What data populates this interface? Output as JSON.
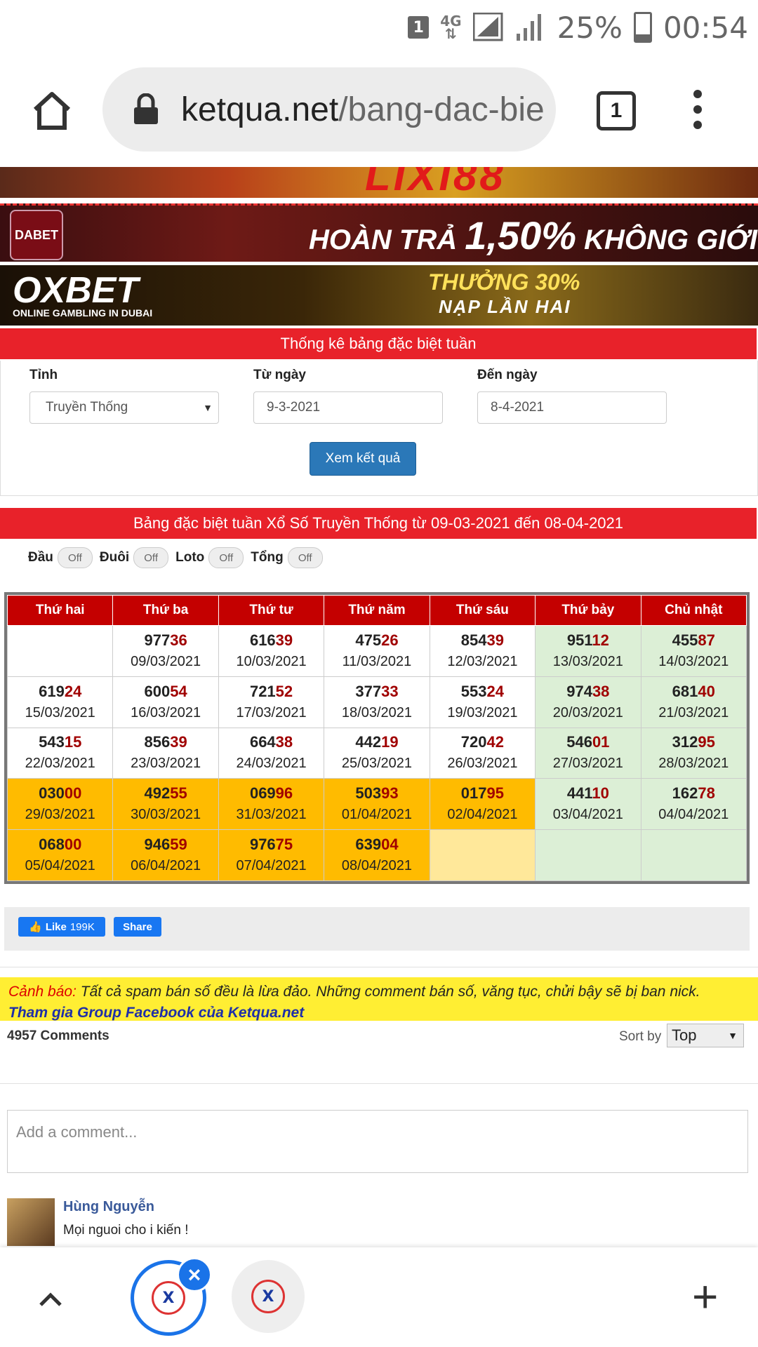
{
  "status_bar": {
    "sim_badge": "1",
    "network": "4G",
    "battery": "25%",
    "time": "00:54"
  },
  "browser": {
    "url_host": "ketqua.net",
    "url_path": "/bang-dac-bie",
    "tab_count": "1"
  },
  "banners": {
    "b1_text": "LIXI88",
    "b2_logo": "DABET",
    "b2_text_a": "HOÀN TRẢ ",
    "b2_text_b": "1,50%",
    "b2_text_c": " KHÔNG GIỚI HẠN",
    "b3_logo": "OXBET",
    "b3_logo_sub": "ONLINE GAMBLING IN DUBAI",
    "b3_text_1": "THƯỞNG 30%",
    "b3_text_2": "NẠP LẦN HAI"
  },
  "form": {
    "title": "Thống kê bảng đặc biệt tuần",
    "province_label": "Tỉnh",
    "province_value": "Truyền Thống",
    "from_label": "Từ ngày",
    "from_value": "9-3-2021",
    "to_label": "Đến ngày",
    "to_value": "8-4-2021",
    "submit_label": "Xem kết quả"
  },
  "table_section": {
    "title": "Bảng đặc biệt tuần Xổ Số Truyền Thống từ 09-03-2021 đến 08-04-2021",
    "toggles": [
      {
        "label": "Đầu",
        "state": "Off"
      },
      {
        "label": "Đuôi",
        "state": "Off"
      },
      {
        "label": "Loto",
        "state": "Off"
      },
      {
        "label": "Tổng",
        "state": "Off"
      }
    ],
    "headers": [
      "Thứ hai",
      "Thứ ba",
      "Thứ tư",
      "Thứ năm",
      "Thứ sáu",
      "Thứ bảy",
      "Chủ nhật"
    ],
    "rows": [
      [
        {
          "num": "",
          "date": ""
        },
        {
          "num": "97736",
          "date": "09/03/2021"
        },
        {
          "num": "61639",
          "date": "10/03/2021"
        },
        {
          "num": "47526",
          "date": "11/03/2021"
        },
        {
          "num": "85439",
          "date": "12/03/2021"
        },
        {
          "num": "95112",
          "date": "13/03/2021"
        },
        {
          "num": "45587",
          "date": "14/03/2021"
        }
      ],
      [
        {
          "num": "61924",
          "date": "15/03/2021"
        },
        {
          "num": "60054",
          "date": "16/03/2021"
        },
        {
          "num": "72152",
          "date": "17/03/2021"
        },
        {
          "num": "37733",
          "date": "18/03/2021"
        },
        {
          "num": "55324",
          "date": "19/03/2021"
        },
        {
          "num": "97438",
          "date": "20/03/2021"
        },
        {
          "num": "68140",
          "date": "21/03/2021"
        }
      ],
      [
        {
          "num": "54315",
          "date": "22/03/2021"
        },
        {
          "num": "85639",
          "date": "23/03/2021"
        },
        {
          "num": "66438",
          "date": "24/03/2021"
        },
        {
          "num": "44219",
          "date": "25/03/2021"
        },
        {
          "num": "72042",
          "date": "26/03/2021"
        },
        {
          "num": "54601",
          "date": "27/03/2021"
        },
        {
          "num": "31295",
          "date": "28/03/2021"
        }
      ],
      [
        {
          "num": "03000",
          "date": "29/03/2021"
        },
        {
          "num": "49255",
          "date": "30/03/2021"
        },
        {
          "num": "06996",
          "date": "31/03/2021"
        },
        {
          "num": "50393",
          "date": "01/04/2021"
        },
        {
          "num": "01795",
          "date": "02/04/2021"
        },
        {
          "num": "44110",
          "date": "03/04/2021"
        },
        {
          "num": "16278",
          "date": "04/04/2021"
        }
      ],
      [
        {
          "num": "06800",
          "date": "05/04/2021"
        },
        {
          "num": "94659",
          "date": "06/04/2021"
        },
        {
          "num": "97675",
          "date": "07/04/2021"
        },
        {
          "num": "63904",
          "date": "08/04/2021"
        },
        {
          "num": "",
          "date": ""
        },
        {
          "num": "",
          "date": ""
        },
        {
          "num": "",
          "date": ""
        }
      ]
    ],
    "row_colors": [
      [
        "white",
        "white",
        "white",
        "white",
        "white",
        "green",
        "green"
      ],
      [
        "white",
        "white",
        "white",
        "white",
        "white",
        "green",
        "green"
      ],
      [
        "white",
        "white",
        "white",
        "white",
        "white",
        "green",
        "green"
      ],
      [
        "yellow",
        "yellow",
        "yellow",
        "yellow",
        "yellow",
        "green",
        "green"
      ],
      [
        "yellow",
        "yellow",
        "yellow",
        "yellow",
        "pale",
        "green",
        "green"
      ]
    ]
  },
  "social": {
    "like_label": "Like",
    "like_count": "199K",
    "share_label": "Share"
  },
  "warning": {
    "prefix": "Cảnh báo:",
    "text": " Tất cả spam bán số đều là lừa đảo. Những comment bán số, văng tục, chửi bậy sẽ bị ban nick.",
    "link": "Tham gia Group Facebook của Ketqua.net"
  },
  "comments": {
    "count": "4957 Comments",
    "sort_label": "Sort by",
    "sort_value": "Top",
    "placeholder": "Add a comment...",
    "first_author": "Hùng Nguyễn",
    "first_text": "Mọi nguoi cho i kiến !"
  },
  "colors": {
    "header_red": "#e8222a",
    "table_head": "#c40000",
    "highlight": "#a00000",
    "yellow": "#ffbb00",
    "green": "#dcefd6",
    "link_blue": "#1a73e8"
  }
}
